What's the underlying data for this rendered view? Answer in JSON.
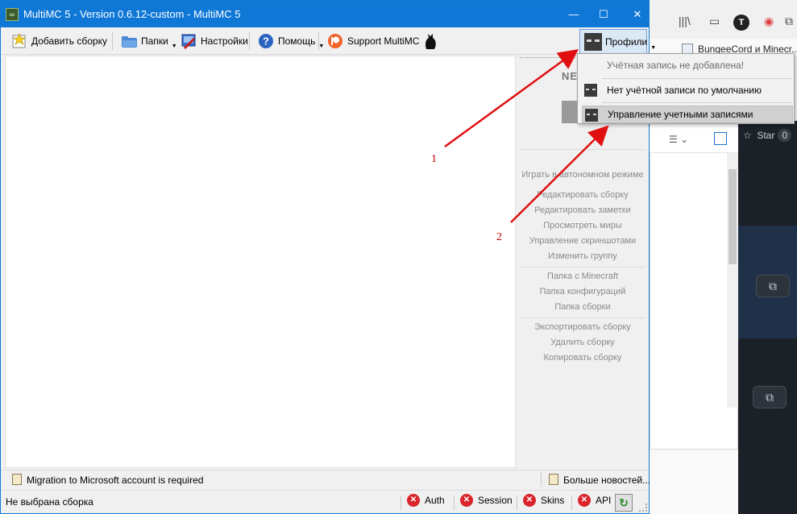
{
  "window": {
    "title": "MultiMC 5 - Version 0.6.12-custom - MultiMC 5",
    "app_icon": "multimc-icon",
    "min_glyph": "—",
    "max_glyph": "☐",
    "close_glyph": "✕"
  },
  "toolbar": {
    "add_instance": "Добавить сборку",
    "folders": "Папки",
    "settings": "Настройки",
    "help": "Помощь",
    "support": "Support MultiMC",
    "profiles": "Профили"
  },
  "profiles_menu": {
    "no_account": "Учётная запись не добавлена!",
    "no_default": "Нет учётной записи по умолчанию",
    "manage": "Управление учетными записями"
  },
  "news_panel": {
    "heading": "NE"
  },
  "instance_actions": [
    "Играть в автономном режиме",
    "Редактировать сборку",
    "Редактировать заметки",
    "Просмотреть миры",
    "Управление скриншотами",
    "Изменить группу",
    "Папка с Minecraft",
    "Папка конфигураций",
    "Папка сборки",
    "Экспортировать сборку",
    "Удалить сборку",
    "Копировать сборку"
  ],
  "status": {
    "migration_notice": "Migration to Microsoft account is required",
    "more_news": "Больше новостей...",
    "selected_instance": "Не выбрана сборка",
    "services": [
      "Auth",
      "Session",
      "Skins",
      "API"
    ]
  },
  "background_browser": {
    "bookmark": "BungeeCord и Minecr...",
    "star_label": "Star",
    "star_count": "0",
    "avatar_letter": "T"
  },
  "annotations": {
    "step1": "1",
    "step2": "2",
    "arrow_color": "#e01010"
  },
  "colors": {
    "titlebar": "#0f78d7",
    "error": "#d9262d"
  }
}
